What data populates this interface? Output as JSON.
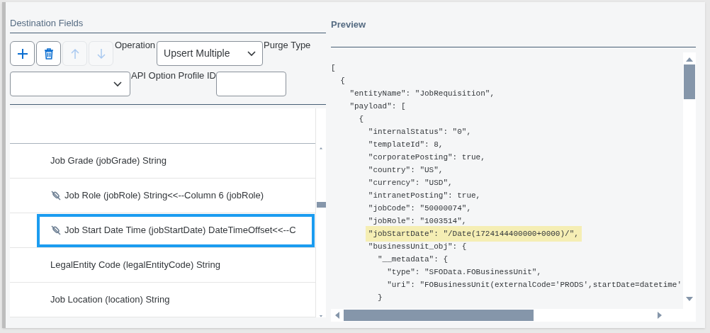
{
  "destination": {
    "title": "Destination Fields",
    "toolbar": [
      {
        "kind": "add",
        "disabled": false
      },
      {
        "kind": "delete",
        "disabled": false
      },
      {
        "kind": "up",
        "disabled": true
      },
      {
        "kind": "down",
        "disabled": true
      }
    ],
    "operation": {
      "label": "Operation",
      "value": "Upsert Multiple"
    },
    "purge_type": {
      "label": "Purge Type"
    },
    "api_option_profile": {
      "label": "API Option Profile ID"
    },
    "fields": [
      {
        "label": "Job Grade (jobGrade) String",
        "mapped": false,
        "selected": false
      },
      {
        "label": "Job Role (jobRole) String<<--Column 6 (jobRole)",
        "mapped": true,
        "selected": false
      },
      {
        "label": "Job Start Date Time (jobStartDate) DateTimeOffset<<--C",
        "mapped": true,
        "selected": true
      },
      {
        "label": "LegalEntity Code (legalEntityCode) String",
        "mapped": false,
        "selected": false
      },
      {
        "label": "Job Location (location) String",
        "mapped": false,
        "selected": false
      }
    ]
  },
  "preview": {
    "title": "Preview",
    "lines": [
      {
        "text": "[",
        "highlighted": false
      },
      {
        "text": "  {",
        "highlighted": false
      },
      {
        "text": "    \"entityName\": \"JobRequisition\",",
        "highlighted": false
      },
      {
        "text": "    \"payload\": [",
        "highlighted": false
      },
      {
        "text": "      {",
        "highlighted": false
      },
      {
        "text": "        \"internalStatus\": \"0\",",
        "highlighted": false
      },
      {
        "text": "        \"templateId\": 8,",
        "highlighted": false
      },
      {
        "text": "        \"corporatePosting\": true,",
        "highlighted": false
      },
      {
        "text": "        \"country\": \"US\",",
        "highlighted": false
      },
      {
        "text": "        \"currency\": \"USD\",",
        "highlighted": false
      },
      {
        "text": "        \"intranetPosting\": true,",
        "highlighted": false
      },
      {
        "text": "        \"jobCode\": \"50000074\",",
        "highlighted": false
      },
      {
        "text": "        \"jobRole\": \"1003514\",",
        "highlighted": false
      },
      {
        "text": "        \"jobStartDate\": \"/Date(1724144400000+0000)/\",",
        "highlighted": true
      },
      {
        "text": "        \"businessUnit_obj\": {",
        "highlighted": false
      },
      {
        "text": "          \"__metadata\": {",
        "highlighted": false
      },
      {
        "text": "            \"type\": \"SFOData.FOBusinessUnit\",",
        "highlighted": false
      },
      {
        "text": "            \"uri\": \"FOBusinessUnit(externalCode='PRODS',startDate=datetime'",
        "highlighted": false
      },
      {
        "text": "          }",
        "highlighted": false
      }
    ]
  }
}
